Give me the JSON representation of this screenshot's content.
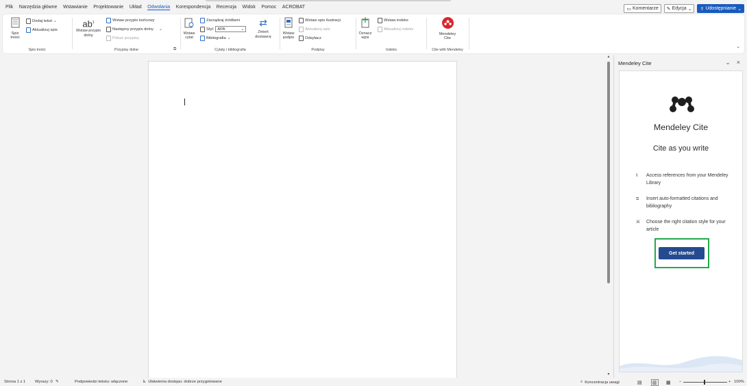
{
  "menu": {
    "tabs": [
      "Plik",
      "Narzędzia główne",
      "Wstawianie",
      "Projektowanie",
      "Układ",
      "Odwołania",
      "Korespondencja",
      "Recenzja",
      "Widok",
      "Pomoc",
      "ACROBAT"
    ],
    "active_tab": "Odwołania",
    "comments": "Komentarze",
    "editing": "Edycja",
    "share": "Udostępnianie"
  },
  "ribbon": {
    "toc": {
      "big_label": "Spis treści",
      "add_text": "Dodaj tekst",
      "update_toc": "Aktualizuj spis",
      "group": "Spis treści"
    },
    "footnotes": {
      "big_label": "Wstaw przypis dolny",
      "big_glyph": "ab",
      "big_sup": "1",
      "insert_endnote": "Wstaw przypis końcowy",
      "next_footnote": "Następny przypis dolny",
      "show_notes": "Pokaż przypisy",
      "group": "Przypisy dolne"
    },
    "citations": {
      "insert_citation": "Wstaw cytat",
      "manage_sources": "Zarządzaj źródłami",
      "style_label": "Styl:",
      "style_value": "APA",
      "bibliography": "Bibliografia",
      "change_provider": "Zmień dostawcę",
      "group": "Cytaty i bibliografia"
    },
    "captions": {
      "insert_caption": "Wstaw podpis",
      "insert_table_of_figures": "Wstaw spis ilustracji",
      "update_table": "Aktualizuj spis",
      "cross_reference": "Odsyłacz",
      "group": "Podpisy"
    },
    "index": {
      "mark_entry": "Oznacz wpis",
      "insert_index": "Wstaw indeks",
      "update_index": "Aktualizuj indeks",
      "group": "Indeks"
    },
    "mendeley": {
      "label": "Mendeley Cite",
      "group": "Cite with Mendeley"
    }
  },
  "pane": {
    "title": "Mendeley Cite",
    "brand": "Mendeley Cite",
    "tagline": "Cite as you write",
    "features": [
      "Access references from your Mendeley Library",
      "Insert auto-formatted citations and bibliography",
      "Choose the right citation style for your article"
    ],
    "cta": "Get started"
  },
  "status": {
    "page": "Strona 1 z 1",
    "words": "Wyrazy: 0",
    "predictions": "Podpowiedzi tekstu: włączone",
    "accessibility": "Ułatwienia dostępu: dobrze przygotowane",
    "focus": "Koncentracja uwagi",
    "zoom": "100%"
  },
  "colors": {
    "accent": "#185abd",
    "mendeley_red": "#d8262d",
    "cta_bg": "#244b8f",
    "highlight": "#21a84a"
  }
}
